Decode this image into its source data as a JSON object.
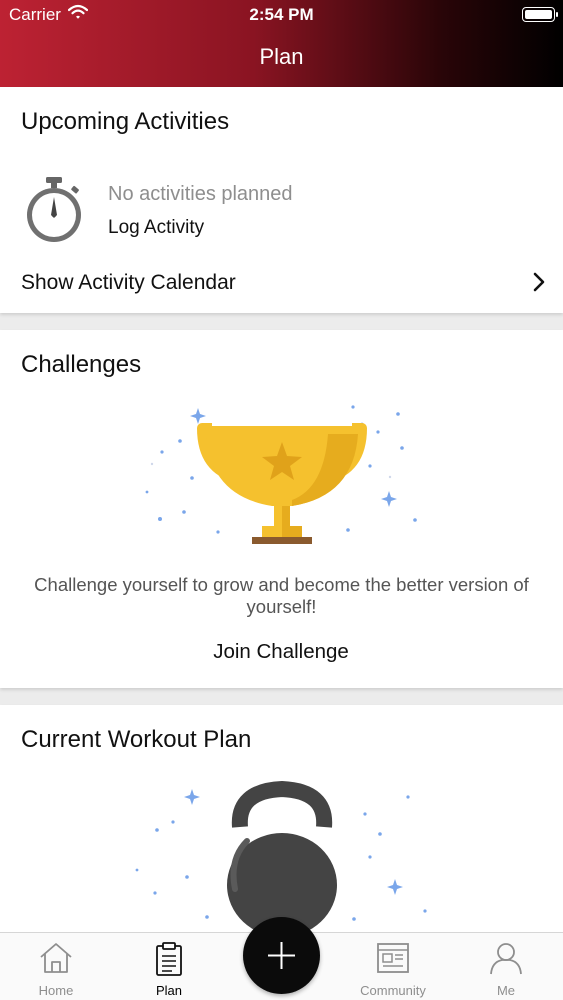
{
  "status_bar": {
    "carrier": "Carrier",
    "time": "2:54 PM"
  },
  "header": {
    "title": "Plan"
  },
  "upcoming": {
    "title": "Upcoming Activities",
    "empty_text": "No activities planned",
    "log_activity": "Log Activity",
    "calendar_link": "Show Activity Calendar"
  },
  "challenges": {
    "title": "Challenges",
    "description": "Challenge yourself to grow and become the better version of yourself!",
    "join_label": "Join Challenge"
  },
  "workout": {
    "title": "Current Workout Plan"
  },
  "tab_bar": {
    "tabs": [
      {
        "label": "Home",
        "icon": "home-icon"
      },
      {
        "label": "Plan",
        "icon": "plan-icon",
        "active": true
      },
      {
        "label": "Community",
        "icon": "community-icon"
      },
      {
        "label": "Me",
        "icon": "profile-icon"
      }
    ],
    "center_action_icon": "plus-icon"
  },
  "colors": {
    "header_gradient_start": "#bd2233",
    "header_gradient_end": "#000000",
    "trophy_gold": "#f5c12e",
    "kettlebell": "#444444",
    "sparkle_blue": "#7aa6ea"
  }
}
